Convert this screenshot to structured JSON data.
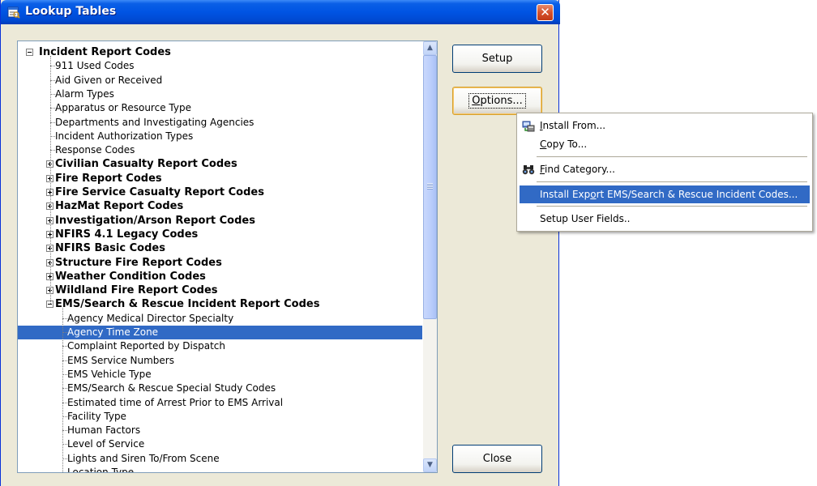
{
  "window": {
    "title": "Lookup Tables"
  },
  "tree": {
    "rows": [
      {
        "label": "Incident Report Codes",
        "kind": "group",
        "state": "minus",
        "top": true
      },
      {
        "label": "911 Used Codes",
        "kind": "child"
      },
      {
        "label": "Aid Given or Received",
        "kind": "child"
      },
      {
        "label": "Alarm Types",
        "kind": "child"
      },
      {
        "label": "Apparatus or Resource Type",
        "kind": "child"
      },
      {
        "label": "Departments and Investigating Agencies",
        "kind": "child"
      },
      {
        "label": "Incident Authorization Types",
        "kind": "child"
      },
      {
        "label": "Response Codes",
        "kind": "child"
      },
      {
        "label": "Civilian Casualty Report Codes",
        "kind": "group",
        "state": "plus"
      },
      {
        "label": "Fire Report Codes",
        "kind": "group",
        "state": "plus"
      },
      {
        "label": "Fire Service Casualty Report Codes",
        "kind": "group",
        "state": "plus"
      },
      {
        "label": "HazMat Report Codes",
        "kind": "group",
        "state": "plus"
      },
      {
        "label": "Investigation/Arson Report Codes",
        "kind": "group",
        "state": "plus"
      },
      {
        "label": "NFIRS 4.1 Legacy Codes",
        "kind": "group",
        "state": "plus"
      },
      {
        "label": "NFIRS Basic Codes",
        "kind": "group",
        "state": "plus"
      },
      {
        "label": "Structure Fire Report Codes",
        "kind": "group",
        "state": "plus"
      },
      {
        "label": "Weather Condition Codes",
        "kind": "group",
        "state": "plus"
      },
      {
        "label": "Wildland Fire Report Codes",
        "kind": "group",
        "state": "plus"
      },
      {
        "label": "EMS/Search & Rescue Incident Report Codes",
        "kind": "group",
        "state": "minus"
      },
      {
        "label": "Agency Medical Director Specialty",
        "kind": "child2"
      },
      {
        "label": "Agency Time Zone",
        "kind": "child2",
        "selected": true
      },
      {
        "label": "Complaint Reported by Dispatch",
        "kind": "child2"
      },
      {
        "label": "EMS Service Numbers",
        "kind": "child2"
      },
      {
        "label": "EMS Vehicle Type",
        "kind": "child2"
      },
      {
        "label": "EMS/Search & Rescue Special Study Codes",
        "kind": "child2"
      },
      {
        "label": "Estimated time of Arrest Prior to EMS Arrival",
        "kind": "child2"
      },
      {
        "label": "Facility Type",
        "kind": "child2"
      },
      {
        "label": "Human Factors",
        "kind": "child2"
      },
      {
        "label": "Level of Service",
        "kind": "child2"
      },
      {
        "label": "Lights and Siren To/From Scene",
        "kind": "child2"
      },
      {
        "label": "Location Type",
        "kind": "child2"
      }
    ]
  },
  "buttons": {
    "setup": "Setup",
    "options_prefix": "O",
    "options_rest": "ptions...",
    "close": "Close"
  },
  "menu": {
    "install_from_u": "I",
    "install_from_rest": "nstall From...",
    "copy_to_u": "C",
    "copy_to_rest": "opy To...",
    "find_u": "F",
    "find_rest": "ind Category...",
    "install_export_pre": "Install Exp",
    "install_export_u": "o",
    "install_export_rest": "rt EMS/Search & Rescue Incident Codes...",
    "setup_user_fields": "Setup User Fields.."
  },
  "colors": {
    "title_blue": "#0054e3",
    "selection": "#316ac5",
    "face": "#ece9d8"
  }
}
